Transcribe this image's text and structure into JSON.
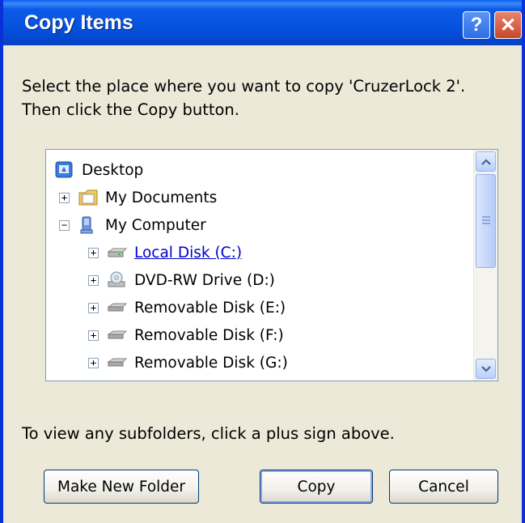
{
  "window": {
    "title": "Copy Items",
    "help_glyph": "?",
    "close_glyph": "✕"
  },
  "instruction": {
    "line1": "Select the place where you want to copy 'CruzerLock 2'.",
    "line2": "Then click the Copy button."
  },
  "tree": {
    "items": [
      {
        "label": "Desktop",
        "icon": "desktop-icon",
        "expander": ""
      },
      {
        "label": "My Documents",
        "icon": "my-documents-icon",
        "expander": "+"
      },
      {
        "label": "My Computer",
        "icon": "my-computer-icon",
        "expander": "−"
      },
      {
        "label": "Local Disk (C:)",
        "icon": "hard-disk-icon",
        "expander": "+",
        "selected": true
      },
      {
        "label": "DVD-RW Drive (D:)",
        "icon": "dvd-drive-icon",
        "expander": "+"
      },
      {
        "label": "Removable Disk (E:)",
        "icon": "removable-disk-icon",
        "expander": "+"
      },
      {
        "label": "Removable Disk (F:)",
        "icon": "removable-disk-icon",
        "expander": "+"
      },
      {
        "label": "Removable Disk (G:)",
        "icon": "removable-disk-icon",
        "expander": "+"
      }
    ]
  },
  "hint": "To view any subfolders, click a plus sign above.",
  "buttons": {
    "make_new_folder": "Make New Folder",
    "copy": "Copy",
    "cancel": "Cancel"
  },
  "colors": {
    "title_bar": "#0553dd",
    "dialog_bg": "#ece9d8",
    "selected_link": "#0000cc"
  }
}
